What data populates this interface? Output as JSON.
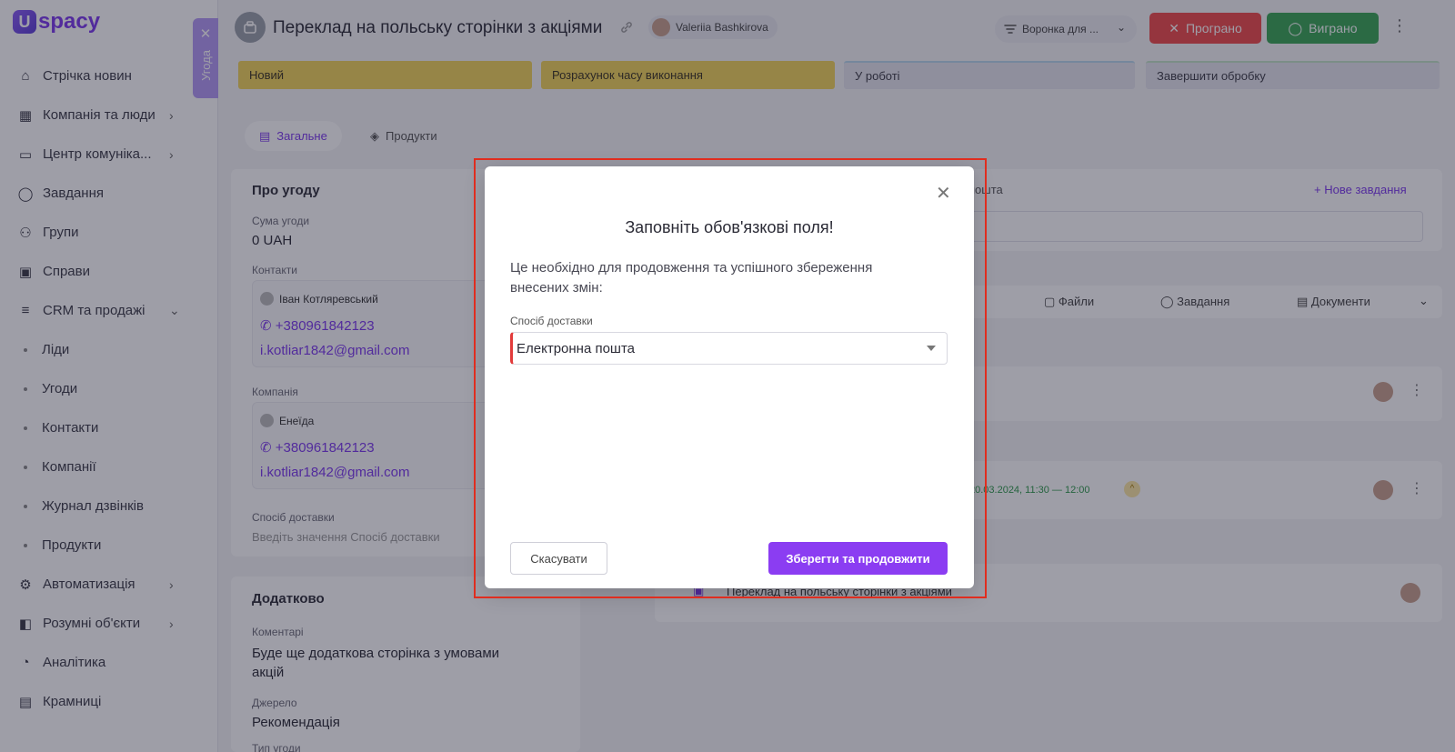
{
  "app": {
    "logo_text": "spacy",
    "logo_mark": "U"
  },
  "sidebar": {
    "items": [
      {
        "label": "Стрічка новин",
        "icon": "home-icon",
        "chevron": false,
        "sub": false
      },
      {
        "label": "Компанія та люди",
        "icon": "company-icon",
        "chevron": true,
        "sub": false
      },
      {
        "label": "Центр комуніка...",
        "icon": "chat-icon",
        "chevron": true,
        "sub": false
      },
      {
        "label": "Завдання",
        "icon": "check-circle-icon",
        "chevron": false,
        "sub": false
      },
      {
        "label": "Групи",
        "icon": "group-icon",
        "chevron": false,
        "sub": false
      },
      {
        "label": "Справи",
        "icon": "calendar-icon",
        "chevron": false,
        "sub": false
      },
      {
        "label": "CRM та продажі",
        "icon": "database-icon",
        "chevron": true,
        "sub": false
      },
      {
        "label": "Ліди",
        "sub": true
      },
      {
        "label": "Угоди",
        "sub": true
      },
      {
        "label": "Контакти",
        "sub": true
      },
      {
        "label": "Компанії",
        "sub": true
      },
      {
        "label": "Журнал дзвінків",
        "sub": true
      },
      {
        "label": "Продукти",
        "sub": true
      },
      {
        "label": "Автоматизація",
        "icon": "automation-icon",
        "chevron": true,
        "sub": false
      },
      {
        "label": "Розумні об'єкти",
        "icon": "smart-objects-icon",
        "chevron": true,
        "sub": false
      },
      {
        "label": "Аналітика",
        "icon": "analytics-icon",
        "chevron": false,
        "sub": false
      },
      {
        "label": "Крамниці",
        "icon": "store-icon",
        "chevron": false,
        "sub": false
      }
    ]
  },
  "side_tab": {
    "label": "Угода",
    "close": "✕"
  },
  "header": {
    "title": "Переклад на польську сторінки з акціями",
    "owner": "Valeriia Bashkirova",
    "funnel": "Воронка для ...",
    "lost_label": "Програно",
    "won_label": "Виграно"
  },
  "stages": [
    "Новий",
    "Розрахунок часу виконання",
    "У роботі",
    "Завершити обробку"
  ],
  "tabs": {
    "general": "Загальне",
    "products": "Продукти"
  },
  "about": {
    "title": "Про угоду",
    "amount_label": "Сума угоди",
    "amount": "0 UAH",
    "contacts_label": "Контакти",
    "contact_name": "Іван Котляревський",
    "contact_phone": "+380961842123",
    "contact_email": "i.kotliar1842@gmail.com",
    "company_label": "Компанія",
    "company_name": "Енеїда",
    "company_phone": "+380961842123",
    "company_email": "i.kotliar1842@gmail.com",
    "delivery_label": "Спосіб доставки",
    "delivery_placeholder": "Введіть значення Спосіб доставки"
  },
  "additional": {
    "title": "Додатково",
    "comments_label": "Коментарі",
    "comments": "Буде ще додаткова сторінка з умовами акцій",
    "source_label": "Джерело",
    "source": "Рекомендація",
    "type_label": "Тип угоди"
  },
  "right": {
    "email_fragment": "пошта",
    "new_task": "Нове завдання",
    "tab_files": "Файли",
    "tab_tasks": "Завдання",
    "tab_docs": "Документи",
    "event_time": "20.03.2024, 11:30 — 12:00",
    "activity_title": "Переклад на польську сторінки з акціями"
  },
  "modal": {
    "title": "Заповніть обов'язкові поля!",
    "description": "Це необхідно для продовження та успішного збереження внесених змін:",
    "field_label": "Спосіб доставки",
    "field_value": "Електронна пошта",
    "cancel": "Скасувати",
    "save": "Зберегти та продовжити"
  },
  "colors": {
    "accent": "#7c3aed",
    "lost": "#ef4a4a",
    "won": "#3aa655",
    "highlight": "#e02d1f"
  }
}
